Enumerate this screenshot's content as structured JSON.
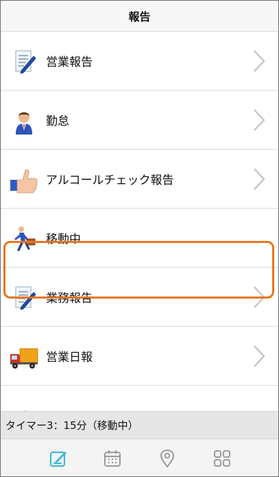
{
  "header": {
    "title": "報告"
  },
  "menu_items": [
    {
      "label": "営業報告",
      "icon": "report-pen-icon"
    },
    {
      "label": "勤怠",
      "icon": "businessman-icon"
    },
    {
      "label": "アルコールチェック報告",
      "icon": "thumbs-up-icon"
    },
    {
      "label": "移動中",
      "icon": "walking-briefcase-icon",
      "selected": true
    },
    {
      "label": "業務報告",
      "icon": "report-pen-icon"
    },
    {
      "label": "営業日報",
      "icon": "delivery-truck-icon"
    },
    {
      "label": "",
      "icon": "box-icon"
    }
  ],
  "timer": {
    "text": "タイマー3：15分（移動中）"
  },
  "tabbar": {
    "items": [
      {
        "icon": "edit-icon",
        "active": true
      },
      {
        "icon": "calendar-icon",
        "active": false
      },
      {
        "icon": "location-pin-icon",
        "active": false
      },
      {
        "icon": "grid-icon",
        "active": false
      }
    ]
  },
  "colors": {
    "accent": "#3fb8d6",
    "highlight": "#e8741e",
    "chevron": "#c7c7cc",
    "tab_inactive": "#9a9a9a"
  }
}
